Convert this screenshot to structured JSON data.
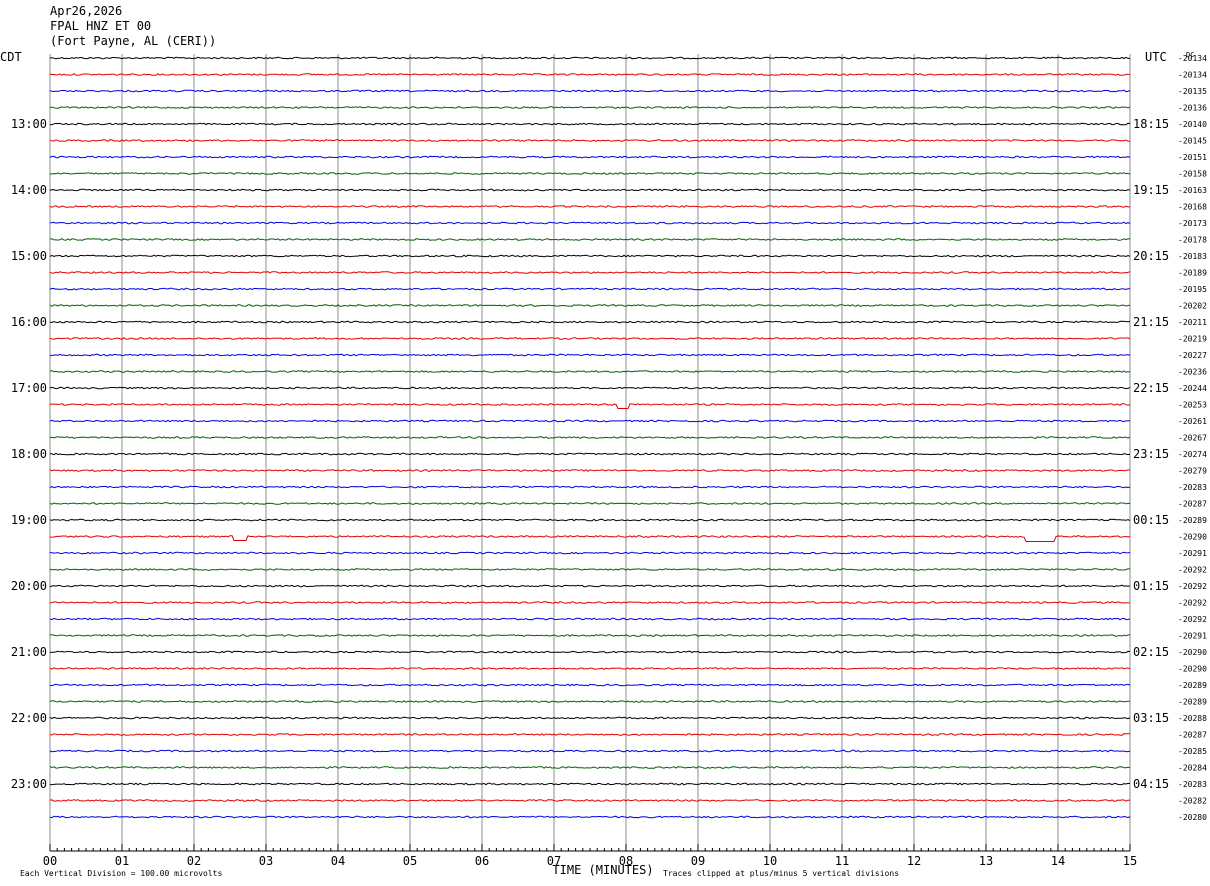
{
  "header": {
    "date": "Apr26,2026",
    "station": "FPAL HNZ ET 00",
    "location": "(Fort Payne, AL (CERI))"
  },
  "chart_data": {
    "type": "line",
    "title": "FPAL HNZ ET 00",
    "left_timezone": "CDT",
    "right_timezone": "UTC",
    "dc_label": "DC",
    "xlabel": "TIME (MINUTES)",
    "x_ticks": [
      "00",
      "01",
      "02",
      "03",
      "04",
      "05",
      "06",
      "07",
      "08",
      "09",
      "10",
      "11",
      "12",
      "13",
      "14",
      "15"
    ],
    "xlim": [
      0,
      15
    ],
    "grid": true,
    "trace_colors": [
      "#000000",
      "#e00000",
      "#0000e0",
      "#006400"
    ],
    "left_hour_labels": [
      "13:00",
      "14:00",
      "15:00",
      "16:00",
      "17:00",
      "18:00",
      "19:00",
      "20:00",
      "21:00",
      "22:00",
      "23:00"
    ],
    "right_hour_labels": [
      "18:15",
      "19:15",
      "20:15",
      "21:15",
      "22:15",
      "23:15",
      "00:15",
      "01:15",
      "02:15",
      "03:15",
      "04:15"
    ],
    "dc_offsets": [
      "-20134",
      "-20134",
      "-20135",
      "-20136",
      "-20140",
      "-20145",
      "-20151",
      "-20158",
      "-20163",
      "-20168",
      "-20173",
      "-20178",
      "-20183",
      "-20189",
      "-20195",
      "-20202",
      "-20211",
      "-20219",
      "-20227",
      "-20236",
      "-20244",
      "-20253",
      "-20261",
      "-20267",
      "-20274",
      "-20279",
      "-20283",
      "-20287",
      "-20289",
      "-20290",
      "-20291",
      "-20292",
      "-20292",
      "-20292",
      "-20292",
      "-20291",
      "-20290",
      "-20290",
      "-20289",
      "-20289",
      "-20288",
      "-20287",
      "-20285",
      "-20284",
      "-20283",
      "-20282",
      "-20280"
    ],
    "footer_left": "Each Vertical Division =  100.00 microvolts",
    "footer_right": "Traces clipped at plus/minus 5 vertical divisions"
  }
}
